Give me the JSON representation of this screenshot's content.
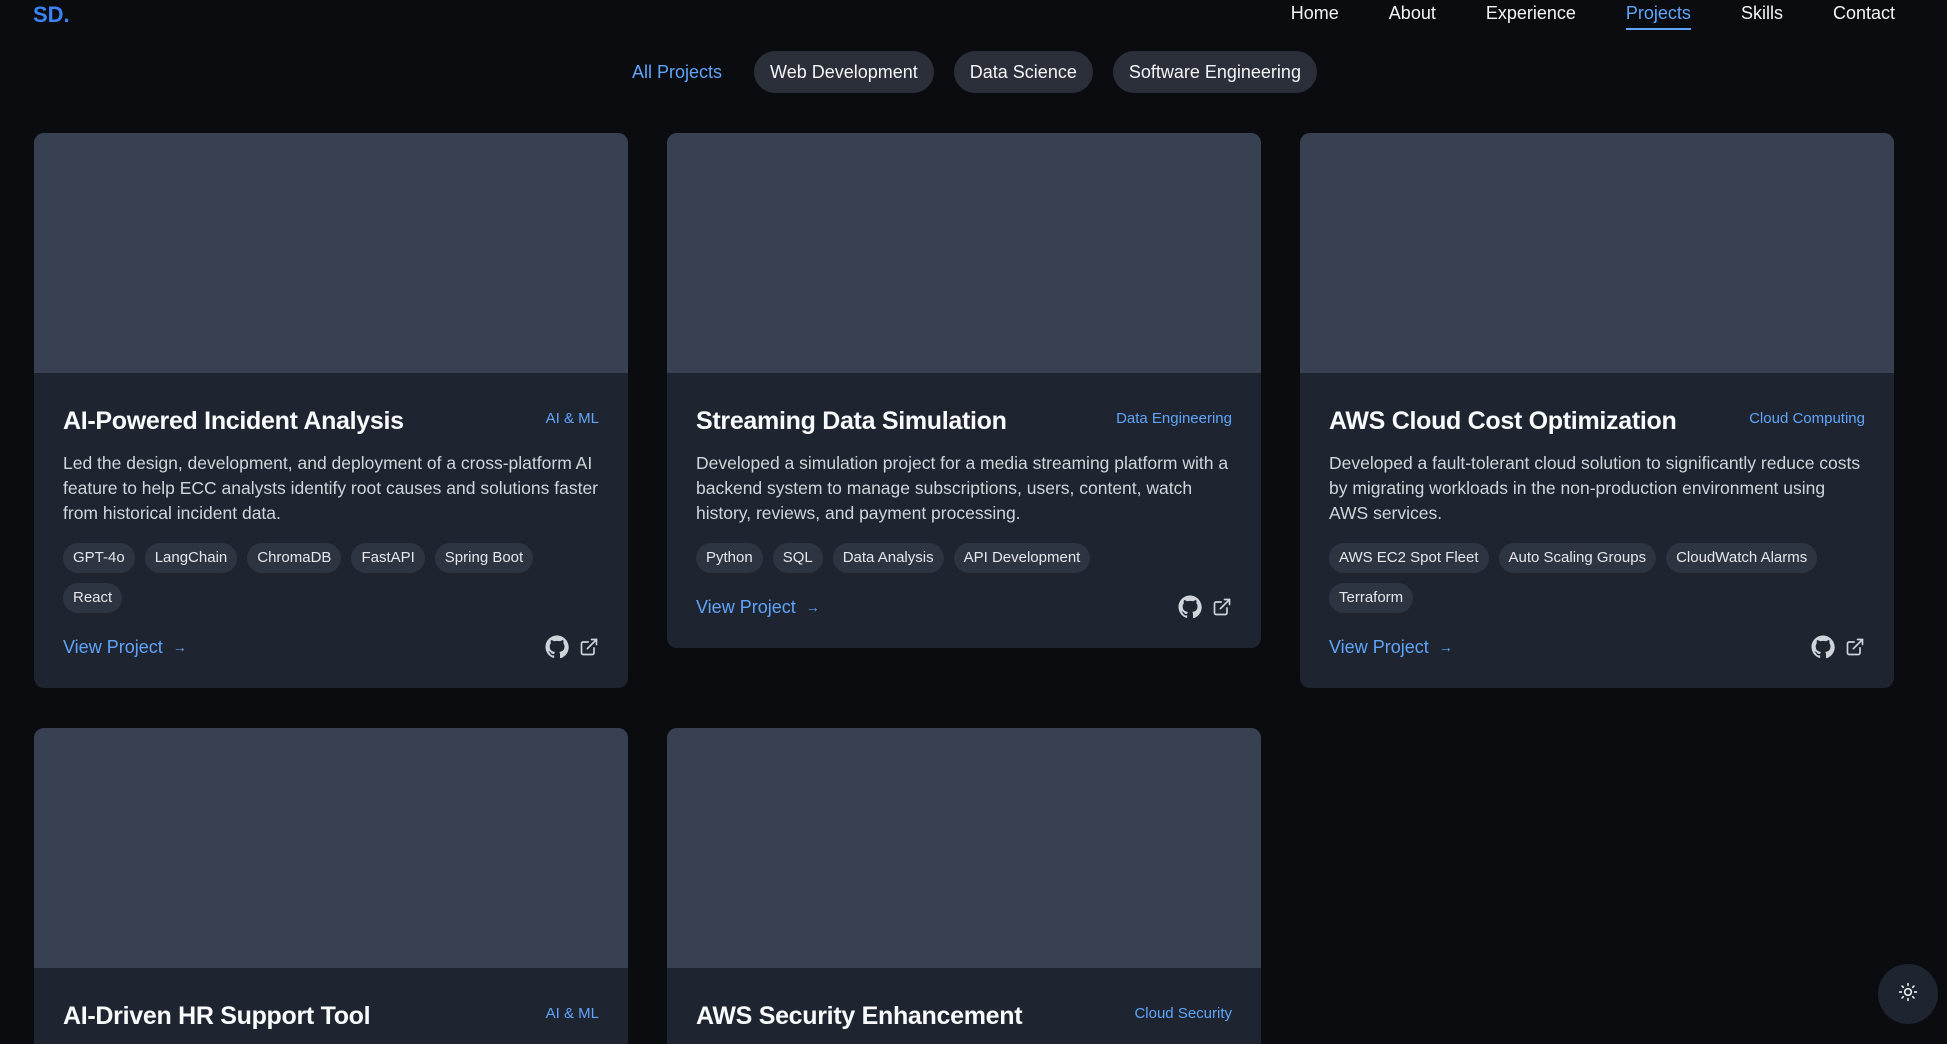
{
  "logo": "SD.",
  "nav": {
    "items": [
      "Home",
      "About",
      "Experience",
      "Projects",
      "Skills",
      "Contact"
    ],
    "active": "Projects"
  },
  "filters": {
    "items": [
      "All Projects",
      "Web Development",
      "Data Science",
      "Software Engineering"
    ],
    "active": "All Projects"
  },
  "projects": [
    {
      "title": "AI-Powered Incident Analysis",
      "category": "AI & ML",
      "description": "Led the design, development, and deployment of a cross-platform AI feature to help ECC analysts identify root causes and solutions faster from historical incident data.",
      "tags": [
        "GPT-4o",
        "LangChain",
        "ChromaDB",
        "FastAPI",
        "Spring Boot",
        "React"
      ],
      "link_label": "View Project"
    },
    {
      "title": "Streaming Data Simulation",
      "category": "Data Engineering",
      "description": "Developed a simulation project for a media streaming platform with a backend system to manage subscriptions, users, content, watch history, reviews, and payment processing.",
      "tags": [
        "Python",
        "SQL",
        "Data Analysis",
        "API Development"
      ],
      "link_label": "View Project"
    },
    {
      "title": "AWS Cloud Cost Optimization",
      "category": "Cloud Computing",
      "description": "Developed a fault-tolerant cloud solution to significantly reduce costs by migrating workloads in the non-production environment using AWS services.",
      "tags": [
        "AWS EC2 Spot Fleet",
        "Auto Scaling Groups",
        "CloudWatch Alarms",
        "Terraform"
      ],
      "link_label": "View Project"
    },
    {
      "title": "AI-Driven HR Support Tool",
      "category": "AI & ML"
    },
    {
      "title": "AWS Security Enhancement",
      "category": "Cloud Security"
    }
  ],
  "icons": {
    "github": "github-icon",
    "external": "external-link-icon",
    "arrow": "arrow-right-icon",
    "theme": "sun-icon"
  },
  "colors": {
    "accent": "#60a5fa",
    "background": "#0b0c10",
    "card": "#1e2430",
    "thumbnail": "#374151",
    "tag": "#2d3442"
  }
}
